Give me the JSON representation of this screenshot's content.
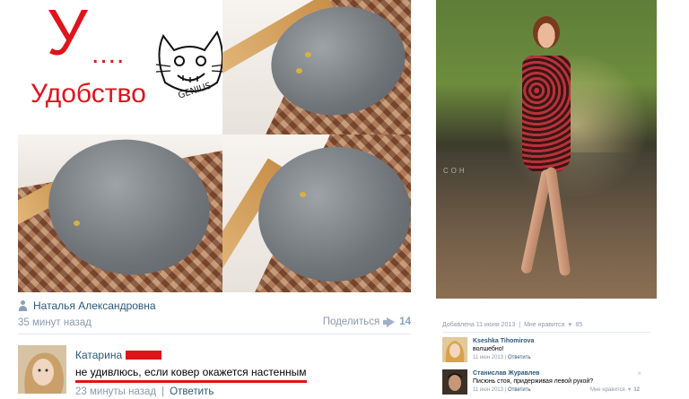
{
  "left_post": {
    "title_letter": "У",
    "title_dots": "....",
    "title_word": "Удобство",
    "genius_label": "GENIUS",
    "author": "Наталья Александровна",
    "time": "35 минут назад",
    "share_label": "Поделиться",
    "share_count": "14",
    "comment": {
      "name": "Катарина",
      "text": "не удивлюсь, если ковер окажется настенным",
      "time": "23 минуты назад",
      "separator": "|",
      "reply": "Ответить"
    }
  },
  "right_post": {
    "watermark": "СОН",
    "meta_date": "Добавлена 11 июня 2013",
    "meta_sep": "|",
    "meta_likes_label": "Мне нравится",
    "meta_heart": "♥",
    "meta_likes": "85",
    "comments": [
      {
        "name": "Kseshka Tihomirova",
        "text": "волшебно!",
        "time": "11 июн 2013",
        "reply": "Ответить"
      },
      {
        "name": "Станислав Журавлев",
        "text": "Писюнь стоя, придерживая левой рукой?",
        "time": "11 июн 2013",
        "reply": "Ответить",
        "like_label": "Мне нравится",
        "like_count": "12",
        "close": "×"
      }
    ]
  },
  "colors": {
    "accent_red": "#e0141c",
    "link_blue": "#2b587a",
    "meta_gray": "#8b9aac"
  }
}
